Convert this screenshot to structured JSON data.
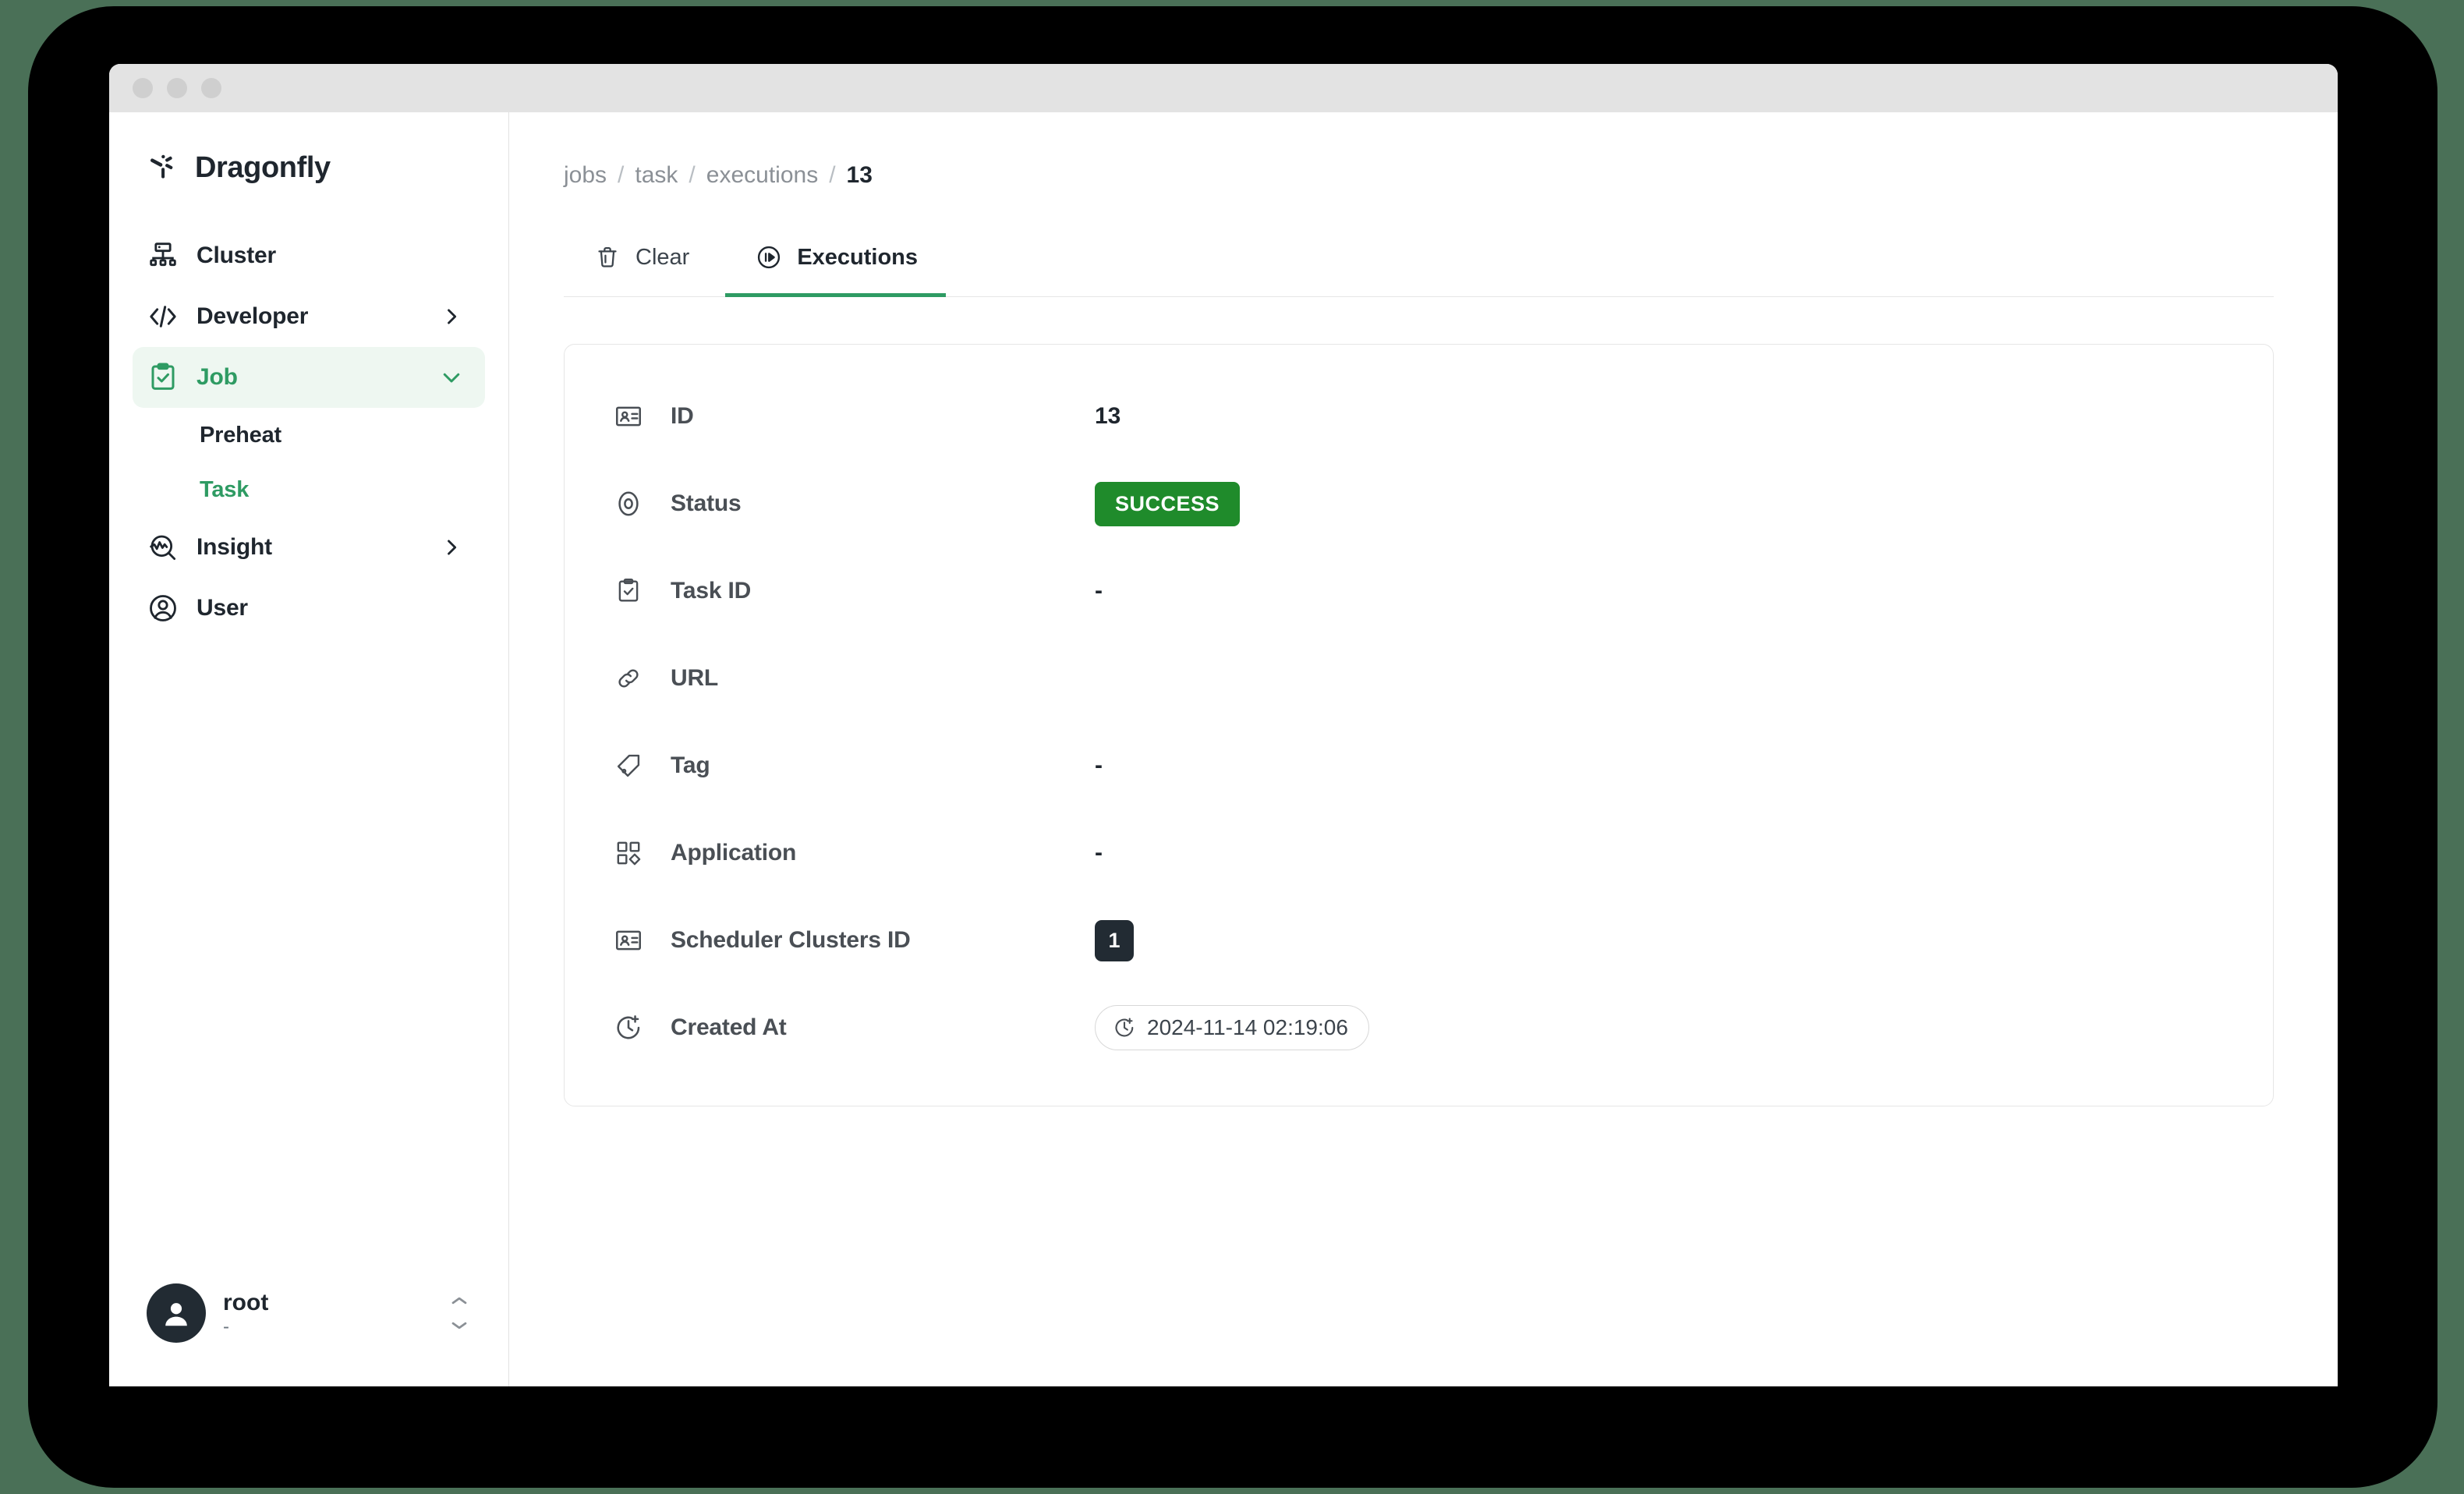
{
  "window": {
    "traffic_lights": [
      "close",
      "minimize",
      "maximize"
    ]
  },
  "sidebar": {
    "brand": {
      "name": "Dragonfly",
      "logo_icon": "dragonfly-logo-icon"
    },
    "items": [
      {
        "label": "Cluster",
        "icon": "cluster-icon",
        "chevron": "none",
        "active": false
      },
      {
        "label": "Developer",
        "icon": "code-icon",
        "chevron": "right",
        "active": false
      },
      {
        "label": "Job",
        "icon": "clipboard-check-icon",
        "chevron": "down",
        "active": true
      },
      {
        "label": "Insight",
        "icon": "insight-search-icon",
        "chevron": "right",
        "active": false
      },
      {
        "label": "User",
        "icon": "user-circle-icon",
        "chevron": "none",
        "active": false
      }
    ],
    "sub_items": [
      {
        "label": "Preheat",
        "active": false
      },
      {
        "label": "Task",
        "active": true
      }
    ],
    "user": {
      "name": "root",
      "sub": "-",
      "avatar_icon": "avatar-icon",
      "selector_icon": "chevron-up-down-icon"
    }
  },
  "main": {
    "breadcrumb": [
      {
        "label": "jobs",
        "current": false
      },
      {
        "label": "task",
        "current": false
      },
      {
        "label": "executions",
        "current": false
      },
      {
        "label": "13",
        "current": true
      }
    ],
    "breadcrumb_separator": "/",
    "tabs": [
      {
        "label": "Clear",
        "icon": "trash-icon",
        "active": false
      },
      {
        "label": "Executions",
        "icon": "play-circle-icon",
        "active": true
      }
    ],
    "details": [
      {
        "label": "ID",
        "icon": "id-card-icon",
        "type": "text",
        "value": "13"
      },
      {
        "label": "Status",
        "icon": "status-circle-icon",
        "type": "badge",
        "value": "SUCCESS"
      },
      {
        "label": "Task ID",
        "icon": "clipboard-check-icon",
        "type": "text",
        "value": "-"
      },
      {
        "label": "URL",
        "icon": "link-icon",
        "type": "skeleton",
        "value": ""
      },
      {
        "label": "Tag",
        "icon": "tag-icon",
        "type": "text",
        "value": "-"
      },
      {
        "label": "Application",
        "icon": "apps-grid-icon",
        "type": "text",
        "value": "-"
      },
      {
        "label": "Scheduler Clusters ID",
        "icon": "id-card-icon",
        "type": "chip",
        "value": "1"
      },
      {
        "label": "Created At",
        "icon": "clock-plus-icon",
        "type": "timechip",
        "value": "2024-11-14 02:19:06"
      }
    ]
  },
  "colors": {
    "accent_green": "#2e9b63",
    "success_green": "#1f8b2b",
    "dark": "#222b33",
    "outer_background": "#4a7057"
  }
}
